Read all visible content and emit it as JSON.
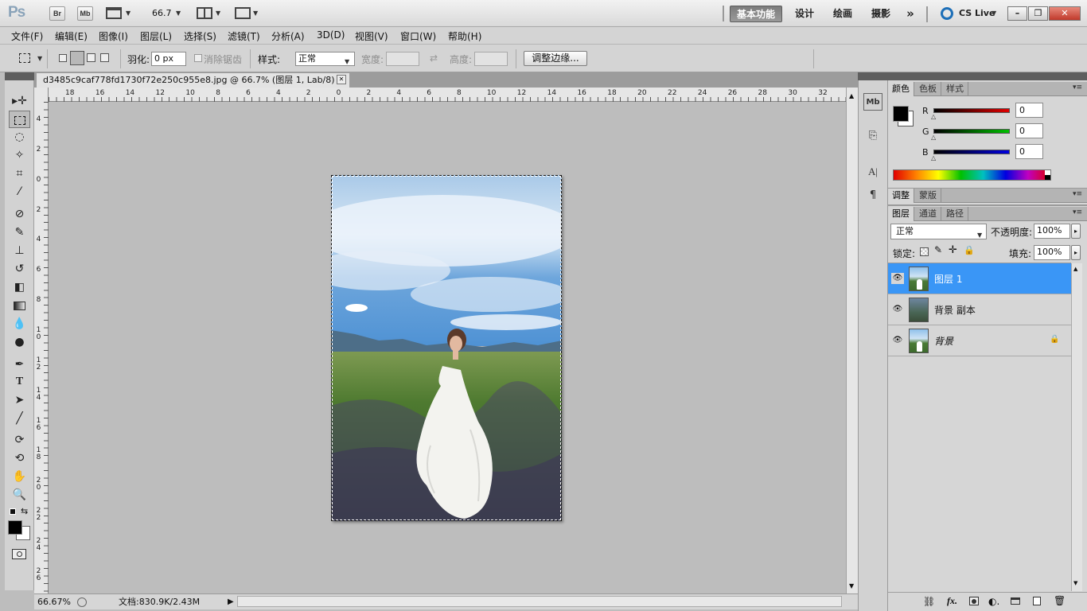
{
  "app": {
    "logo": "Ps",
    "bridge_btn": "Br",
    "minibridge_btn": "Mb",
    "zoom_value": "66.7",
    "workspaces": [
      "基本功能",
      "设计",
      "绘画",
      "摄影"
    ],
    "more": "»",
    "cslive": "CS Live",
    "window_buttons": [
      "–",
      "❐",
      "✕"
    ]
  },
  "menu": [
    "文件(F)",
    "编辑(E)",
    "图像(I)",
    "图层(L)",
    "选择(S)",
    "滤镜(T)",
    "分析(A)",
    "3D(D)",
    "视图(V)",
    "窗口(W)",
    "帮助(H)"
  ],
  "options": {
    "feather_label": "羽化:",
    "feather_value": "0 px",
    "antialias_label": "消除锯齿",
    "style_label": "样式:",
    "style_value": "正常",
    "width_label": "宽度:",
    "height_label": "高度:",
    "refine_button": "调整边缘..."
  },
  "document": {
    "tab_title": "d3485c9caf778fd1730f72e250c955e8.jpg @ 66.7% (图层 1, Lab/8) *",
    "close": "✕",
    "ruler_h": [
      "18",
      "16",
      "14",
      "12",
      "10",
      "8",
      "6",
      "4",
      "2",
      "0",
      "2",
      "4",
      "6",
      "8",
      "10",
      "12",
      "14",
      "16",
      "18",
      "20",
      "22",
      "24",
      "26",
      "28",
      "30",
      "32"
    ],
    "ruler_v": [
      "4",
      "2",
      "0",
      "2",
      "4",
      "6",
      "8",
      "1 0",
      "1 2",
      "1 4",
      "1 6",
      "1 8",
      "2 0",
      "2 2",
      "2 4",
      "2 6"
    ]
  },
  "status": {
    "zoom": "66.67%",
    "doc": "文档:830.9K/2.43M"
  },
  "color_panel": {
    "tabs": [
      "颜色",
      "色板",
      "样式"
    ],
    "channels": [
      {
        "label": "R",
        "value": "0",
        "color": "#e00000"
      },
      {
        "label": "G",
        "value": "0",
        "color": "#00c000"
      },
      {
        "label": "B",
        "value": "0",
        "color": "#0000e0"
      }
    ]
  },
  "adjust_panel": {
    "tabs": [
      "调整",
      "蒙版"
    ]
  },
  "layers_panel": {
    "tabs": [
      "图层",
      "通道",
      "路径"
    ],
    "blend_mode": "正常",
    "opacity_label": "不透明度:",
    "opacity_value": "100%",
    "lock_label": "锁定:",
    "fill_label": "填充:",
    "fill_value": "100%",
    "layers": [
      {
        "name": "图层 1",
        "selected": true
      },
      {
        "name": "背景 副本",
        "selected": false
      },
      {
        "name": "背景",
        "selected": false,
        "locked": true
      }
    ],
    "bottom_icons": [
      "link-icon",
      "fx-icon",
      "mask-icon",
      "adjustment-icon",
      "group-icon",
      "new-layer-icon",
      "trash-icon"
    ]
  }
}
